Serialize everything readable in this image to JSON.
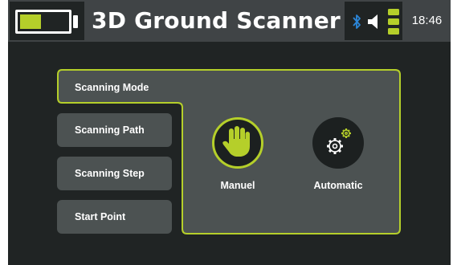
{
  "header": {
    "title": "3D Ground Scanner",
    "time": "18:46",
    "battery_level": 0.45
  },
  "icons": {
    "battery": "battery-icon",
    "bluetooth": "bluetooth-icon",
    "volume": "speaker-icon",
    "signal": "signal-level-icon",
    "manuel": "hand-icon",
    "automatic": "gears-icon"
  },
  "menu": {
    "items": [
      {
        "label": "Scanning Mode",
        "active": true
      },
      {
        "label": "Scanning Path",
        "active": false
      },
      {
        "label": "Scanning Step",
        "active": false
      },
      {
        "label": "Start Point",
        "active": false
      }
    ]
  },
  "modes": {
    "manuel_label": "Manuel",
    "automatic_label": "Automatic",
    "selected": "Manuel"
  },
  "colors": {
    "accent": "#b5cf2a",
    "bluetooth": "#2b86d8",
    "panel": "#4c5252",
    "screen": "#202424",
    "statusbar": "#404446"
  }
}
